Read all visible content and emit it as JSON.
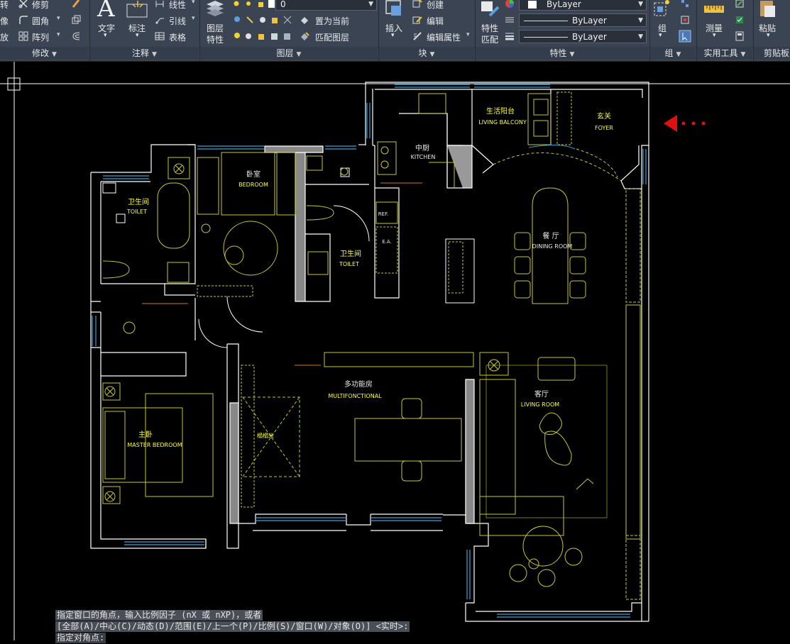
{
  "ribbon": {
    "modify": {
      "rotate": "转",
      "trim": "修剪",
      "mirror": "像",
      "fillet": "圆角",
      "scale": "放",
      "array": "阵列"
    },
    "annotation": {
      "text": "文字",
      "dimension": "标注",
      "linear": "线性",
      "leader": "引线",
      "table": "表格"
    },
    "layers": {
      "layer_props_line1": "图层",
      "layer_props_line2": "特性",
      "current_layer": "0",
      "make_current": "置为当前",
      "match_layer": "匹配图层"
    },
    "block": {
      "insert": "插入",
      "create": "创建",
      "edit": "编辑",
      "edit_attr": "编辑属性"
    },
    "properties": {
      "match_line1": "特性",
      "match_line2": "匹配",
      "color": "ByLayer",
      "linetype": "ByLayer",
      "lineweight": "ByLayer"
    },
    "group": {
      "group": "组"
    },
    "utilities": {
      "measure": "测量"
    },
    "clipboard": {
      "paste": "粘贴"
    },
    "panels": {
      "modify": "修改",
      "annotation": "注释",
      "layers": "图层",
      "block": "块",
      "properties": "特性",
      "groups": "组",
      "utilities": "实用工具",
      "clipboard": "剪贴板"
    }
  },
  "drawing": {
    "rooms": {
      "balcony_cn": "生活阳台",
      "balcony_en": "LIVING BALCONY",
      "foyer_cn": "玄关",
      "foyer_en": "FOYER",
      "kitchen_cn": "中厨",
      "kitchen_en": "KITCHEN",
      "bedroom_cn": "卧室",
      "bedroom_en": "BEDROOM",
      "toilet1_cn": "卫生间",
      "toilet1_en": "TOILET",
      "toilet2_cn": "卫生间",
      "toilet2_en": "TOILET",
      "dining_cn": "餐 厅",
      "dining_en": "DINING ROOM",
      "multi_cn": "多功能房",
      "multi_en": "MULTIFONCTIONAL",
      "living_cn": "客厅",
      "living_en": "LIVING ROOM",
      "master_cn": "主卧",
      "master_en": "MASTER BEDROOM",
      "tatami_cn": "榻榻米",
      "ref": "REF.",
      "ea": "E.A."
    }
  },
  "command": {
    "line1": "指定窗口的角点，输入比例因子 (nX 或 nXP)，或者",
    "line2": "[全部(A)/中心(C)/动态(D)/范围(E)/上一个(P)/比例(S)/窗口(W)/对象(O)] <实时>:",
    "line3": "指定对角点:"
  },
  "colors": {
    "ribbon": "#3b4453",
    "wall": "#ffffff",
    "furniture": "#c8c832",
    "window": "#3aa0d8",
    "label": "#ffff30",
    "arrow": "#e01010"
  }
}
